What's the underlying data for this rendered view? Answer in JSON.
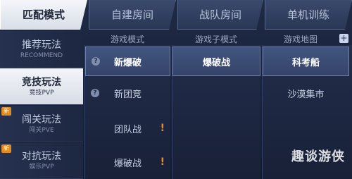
{
  "tabs": [
    {
      "label": "匹配模式",
      "active": true
    },
    {
      "label": "自建房间",
      "active": false
    },
    {
      "label": "战队房间",
      "active": false
    },
    {
      "label": "单机训练",
      "active": false
    }
  ],
  "sidebar": {
    "items": [
      {
        "label": "推荐玩法",
        "sub": "RECOMMEND",
        "active": false,
        "badge": ""
      },
      {
        "label": "竞技玩法",
        "sub": "竞技PVP",
        "active": true,
        "badge": ""
      },
      {
        "label": "闯关玩法",
        "sub": "闯关PVE",
        "active": false,
        "badge": "新"
      },
      {
        "label": "对抗玩法",
        "sub": "娱乐PVP",
        "active": false,
        "badge": "新"
      }
    ]
  },
  "columns": {
    "mode": {
      "header": "游戏模式",
      "items": [
        {
          "label": "新爆破",
          "selected": true,
          "help": true,
          "warn": false
        },
        {
          "label": "新团竞",
          "selected": false,
          "help": true,
          "warn": false
        },
        {
          "label": "团队战",
          "selected": false,
          "help": false,
          "warn": true
        },
        {
          "label": "爆破战",
          "selected": false,
          "help": false,
          "warn": true
        }
      ]
    },
    "submode": {
      "header": "游戏子模式",
      "items": [
        {
          "label": "爆破战",
          "selected": true
        }
      ]
    },
    "map": {
      "header": "游戏地图",
      "items": [
        {
          "label": "科考船",
          "selected": true
        },
        {
          "label": "沙漠集市",
          "selected": false
        }
      ]
    }
  },
  "icons": {
    "help": "?",
    "warn": "!",
    "plus": "+"
  },
  "watermark": "趣谈游侠"
}
